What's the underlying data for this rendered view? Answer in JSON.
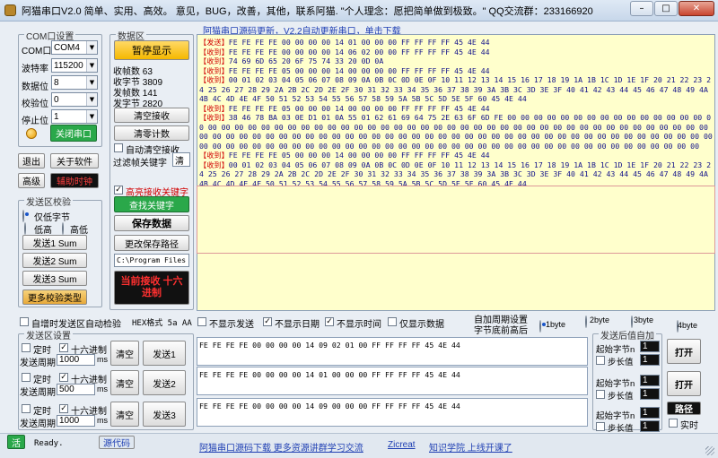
{
  "window": {
    "title": "阿猫串口V2.0  简单、实用、高效。  意见，BUG，改善，其他，联系阿猫.  \"个人理念：愿把简单做到极致。\"  QQ交流群：233166920",
    "min_icon": "minimize-icon",
    "max_icon": "maximize-icon",
    "close_icon": "close-icon",
    "min": "–",
    "max": "□",
    "close": "✕"
  },
  "com": {
    "group_label": "COM口设置",
    "port_label": "COM口",
    "port": "COM4",
    "baud_label": "波特率",
    "baud": "115200",
    "databits_label": "数据位",
    "databits": "8",
    "parity_label": "校验位",
    "parity": "0",
    "stopbits_label": "停止位",
    "stopbits": "1",
    "close_port": "关闭串口",
    "exit": "退出",
    "about": "关于软件",
    "advanced": "高级",
    "assist": "辅助时钟"
  },
  "checksum": {
    "group_label": "发送区校验",
    "only_low": "仅低字节",
    "low": "低高",
    "high": "高低",
    "send1": "发送1 Sum",
    "send2": "发送2 Sum",
    "send3": "发送3 Sum",
    "more": "更多校验类型"
  },
  "data": {
    "group_label": "数据区",
    "pause": "暂停显示",
    "recv_frames": "收帧数 63",
    "recv_bytes": "收字节 3809",
    "send_frames": "发帧数 141",
    "send_bytes": "发字节 2820",
    "clear_recv": "清空接收",
    "clear_count": "清零计数",
    "auto_clear": "自动清空接收",
    "filter_label": "过滤帧关键字",
    "filter_value": "清",
    "highlight": "高亮接收关键字",
    "find_keyword": "查找关键字",
    "save": "保存数据",
    "change_path": "更改保存路径",
    "path": "C:\\Program Files",
    "mode": "当前接收 十六进制"
  },
  "recv": {
    "header": "阿猫串口源码更新，V2.2自动更新串口，单击下载",
    "lines": [
      {
        "tag": "【发送】",
        "text": "FE FE FE FE 00 00 00 00 14 01 00 00 00 FF FF FF FF 45 4E 44"
      },
      {
        "tag": "【收到】",
        "text": "FE FE FE FE 00 00 00 00 14 06 02 00 00 FF FF FF FF 45 4E 44"
      },
      {
        "tag": "【收到】",
        "text": "74 69 6D 65 20 6F 75 74 33 20 0D 0A"
      },
      {
        "tag": "【收到】",
        "text": "FE FE FE FE 05 00 00 00 14 00 00 00 00 FF FF FF FF 45 4E 44"
      },
      {
        "tag": "【收到】",
        "text": "00 01 02 03 04 05 06 07 08 09 0A 0B 0C 0D 0E 0F 10 11 12 13 14 15 16 17 18 19 1A 1B 1C 1D 1E 1F 20 21 22 23 24 25 26 27 28 29 2A 2B 2C 2D 2E 2F 30 31 32 33 34 35 36 37 38 39 3A 3B 3C 3D 3E 3F 40 41 42 43 44 45 46 47 48 49 4A 4B 4C 4D 4E 4F 50 51 52 53 54 55 56 57 58 59 5A 5B 5C 5D 5E 5F 60 45 4E 44"
      },
      {
        "tag": "【收到】",
        "text": "FE FE FE FE 05 00 00 00 14 00 00 00 00 FF FF FF FF 45 4E 44"
      },
      {
        "tag": "【收到】",
        "text": "38 46 78 BA 03 0E D1 01 0A 55 01 62 61 69 64 75 2E 63 6F 6D FE 00 00 00 00 00 00 00 00 00 00 00 00 00 00 00 00 00 00 00 00 00 00 00 00 00 00 00 00 00 00 00 00 00 00 00 00 00 00 00 00 00 00 00 00 00 00 00 00 00 00 00 00 00 00 00 00 00 00 00 00 00 00 00 00 00 00 00 00 00 00 00 00 00 00 00 00 00 00 00 00 00 00 00 00 00 00 00 00 00 00 00 00 00 00 00 00 00 00 00 00 00 00 00 00 00 00 00 00 00 00 00 00 00 00 00 00 00 00 00 00 00 00 00 00 00 00 00 00 00 00 00"
      },
      {
        "tag": "【收到】",
        "text": "FE FE FE FE 05 00 00 00 14 00 00 00 00 FF FF FF FF 45 4E 44"
      },
      {
        "tag": "【收到】",
        "text": "00 01 02 03 04 05 06 07 08 09 0A 0B 0C 0D 0E 0F 10 11 12 13 14 15 16 17 18 19 1A 1B 1C 1D 1E 1F 20 21 22 23 24 25 26 27 28 29 2A 2B 2C 2D 2E 2F 30 31 32 33 34 35 36 37 38 39 3A 3B 3C 3D 3E 3F 40 41 42 43 44 45 46 47 48 49 4A 4B 4C 4D 4E 4F 50 51 52 53 54 55 56 57 58 59 5A 5B 5C 5D 5E 5F 60 45 4E 44"
      }
    ]
  },
  "options": {
    "auto_checksum": "自增时发送区自动检验",
    "hex_format": "HEX格式 5a AA",
    "hide_send": "不显示发送",
    "hide_date": "不显示日期",
    "hide_time": "不显示时间",
    "only_data": "仅显示数据",
    "period_title": "自加周期设置",
    "byte_order": "字节底前高后",
    "b1": "1byte",
    "b2": "2byte",
    "b3": "3byte",
    "b4": "4byte"
  },
  "send": {
    "group_label": "发送区设置",
    "timed": "定时",
    "hex": "十六进制",
    "period": "发送周期",
    "unit": "ms",
    "clear": "清空",
    "rows": [
      {
        "period": "1000",
        "btn": "发送1",
        "text": "FE FE FE FE 00 00 00 00 14 09 02 01 00 FF FF FF FF 45 4E 44"
      },
      {
        "period": "500",
        "btn": "发送2",
        "text": "FE FE FE FE 00 00 00 00 14 01 00 00 00 FF FF FF FF 45 4E 44"
      },
      {
        "period": "1000",
        "btn": "发送3",
        "text": "FE FE FE FE 00 00 00 00 14 09 00 00 00 FF FF FF FF 45 4E 44"
      }
    ]
  },
  "autoinc": {
    "group_label": "发送后值自加",
    "start": "起始字节n",
    "step": "步长值",
    "value": "1",
    "open": "打开",
    "route": "路径",
    "realtime": "实时"
  },
  "status": {
    "live": "活",
    "ready": "Ready.",
    "source": "源代码",
    "download": "阿猫串口源码下载  更多资源讲群学习交流",
    "zicreat": "Zicreat",
    "zhidao": "知识学院 上线开课了"
  }
}
